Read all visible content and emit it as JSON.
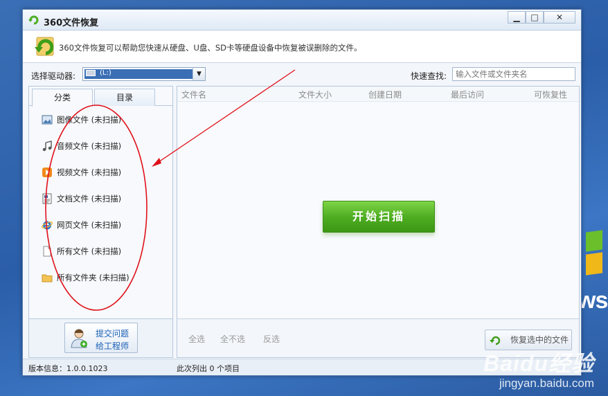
{
  "window": {
    "title": "360文件恢复"
  },
  "info": {
    "text": "360文件恢复可以帮助您快速从硬盘、U盘、SD卡等硬盘设备中恢复被误删除的文件。"
  },
  "drive": {
    "label": "选择驱动器:",
    "value": "(L:)",
    "search_label": "快速查找:",
    "search_placeholder": "输入文件或文件夹名"
  },
  "tabs": [
    {
      "label": "分类"
    },
    {
      "label": "目录"
    }
  ],
  "categories": [
    {
      "label": "图像文件 (未扫描)",
      "icon": "image-icon"
    },
    {
      "label": "音频文件 (未扫描)",
      "icon": "music-icon"
    },
    {
      "label": "视频文件 (未扫描)",
      "icon": "video-icon"
    },
    {
      "label": "文档文件 (未扫描)",
      "icon": "document-icon"
    },
    {
      "label": "网页文件 (未扫描)",
      "icon": "ie-icon"
    },
    {
      "label": "所有文件 (未扫描)",
      "icon": "file-icon"
    },
    {
      "label": "所有文件夹 (未扫描)",
      "icon": "folder-icon"
    }
  ],
  "feedback": {
    "line1": "提交问题",
    "line2": "给工程师"
  },
  "columns": [
    "文件名",
    "文件大小",
    "创建日期",
    "最后访问",
    "可恢复性"
  ],
  "scan_button": "开始扫描",
  "selection": {
    "all": "全选",
    "none": "全不选",
    "invert": "反选"
  },
  "restore_button": "恢复选中的文件",
  "status": {
    "version": "版本信息：1.0.0.1023",
    "count": "此次列出 0 个项目"
  },
  "desktop": {
    "logo_text": "ws"
  },
  "watermark": {
    "line1": "Baidu经验",
    "line2": "jingyan.baidu.com"
  },
  "colors": {
    "scan_green": "#4fae22",
    "annotation_red": "#e0101a",
    "desktop_blue": "#2b5ea8"
  }
}
